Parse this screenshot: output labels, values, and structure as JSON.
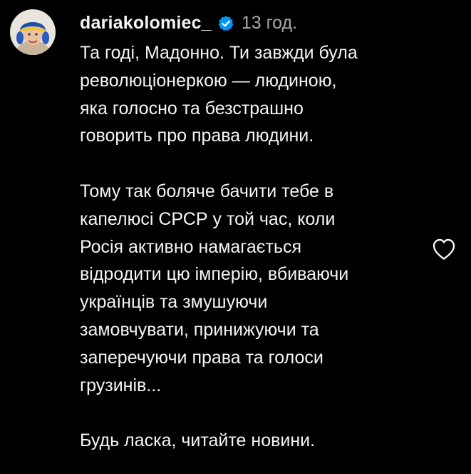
{
  "comment": {
    "username": "dariakolomiec_",
    "verified": true,
    "timestamp": "13 год.",
    "paragraphs": [
      "Та годі, Мадонно. Ти завжди була\nреволюціонеркою — людиною,\nяка голосно та безстрашно\nговорить про права людини.",
      "Тому так боляче бачити тебе в\nкапелюсі СРСР у той час, коли\nРосія активно намагається\nвідродити цю імперію, вбиваючи\nукраїнців та змушуючи\nзамовчувати, принижуючи та\nзаперечуючи права та голоси\nгрузинів...",
      "Будь ласка, читайте новини."
    ]
  },
  "icons": {
    "verified": "verified-badge-icon",
    "like": "heart-outline-icon"
  },
  "colors": {
    "background": "#000000",
    "text": "#f5f5f5",
    "muted": "#a8a8a8",
    "verified": "#0095f6"
  }
}
